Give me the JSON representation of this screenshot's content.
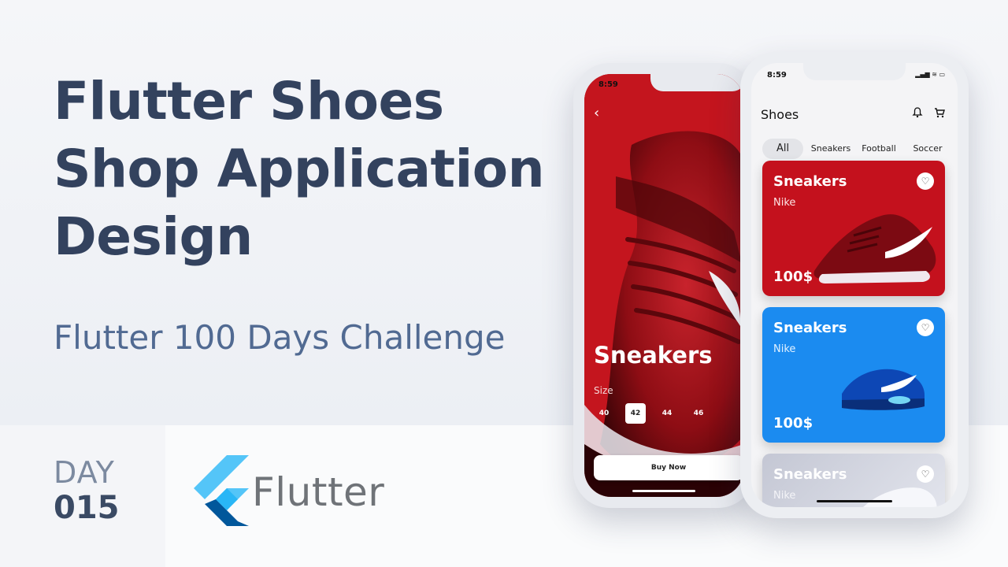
{
  "headline": {
    "line1": "Flutter Shoes",
    "line2": "Shop Application",
    "line3": "Design"
  },
  "subtitle": "Flutter 100 Days Challenge",
  "day": {
    "label": "DAY",
    "number": "015"
  },
  "brand": {
    "word": "Flutter",
    "colors": {
      "light": "#54c5f8",
      "dark": "#01579b"
    }
  },
  "detail_phone": {
    "time": "8:59",
    "title": "Sneakers",
    "size_label": "Size",
    "sizes": [
      "40",
      "42",
      "44",
      "46"
    ],
    "selected_size": "42",
    "buy_label": "Buy Now",
    "shoe_logo": "NIKE",
    "accent": "#b2101a"
  },
  "list_phone": {
    "time": "8:59",
    "title": "Shoes",
    "tabs": [
      "All",
      "Sneakers",
      "Football",
      "Soccer"
    ],
    "active_tab": "All",
    "cards": [
      {
        "name": "Sneakers",
        "brand": "Nike",
        "price": "100$",
        "color": "#c4111d"
      },
      {
        "name": "Sneakers",
        "brand": "Nike",
        "price": "100$",
        "color": "#1b8bf0"
      },
      {
        "name": "Sneakers",
        "brand": "Nike",
        "price": "",
        "color": "#c4c7d4"
      }
    ]
  }
}
